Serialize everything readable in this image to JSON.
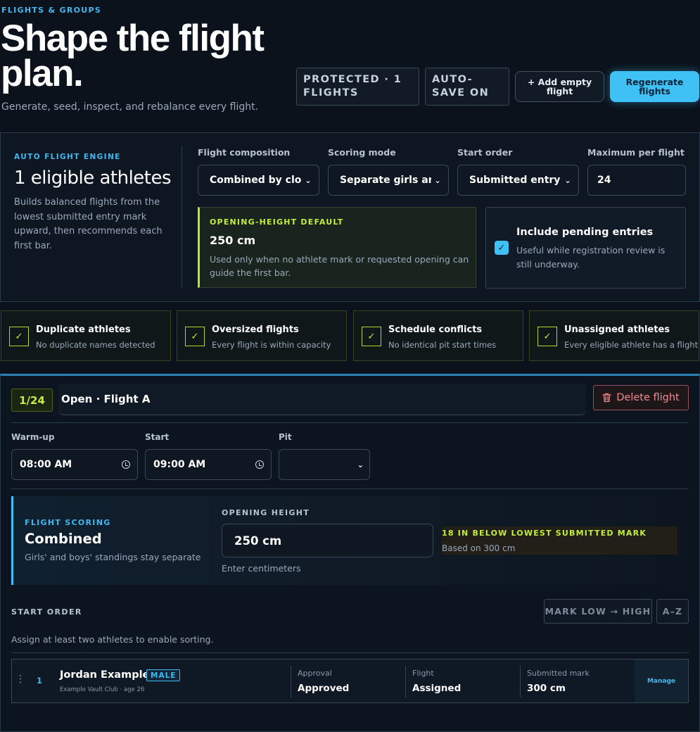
{
  "header": {
    "eyebrow": "FLIGHTS & GROUPS",
    "title": "Shape the flight plan.",
    "subtitle": "Generate, seed, inspect, and rebalance every flight.",
    "protected_pill": "PROTECTED · 1 FLIGHTS",
    "autosave_pill": "AUTO-SAVE ON",
    "add_empty_label": "+ Add empty flight",
    "regenerate_label": "Regenerate flights"
  },
  "engine": {
    "eyebrow": "AUTO FLIGHT ENGINE",
    "title": "1 eligible athletes",
    "description": "Builds balanced flights from the lowest submitted entry mark upward, then recommends each first bar.",
    "composition": {
      "label": "Flight composition",
      "value": "Combined by closest mark"
    },
    "scoring": {
      "label": "Scoring mode",
      "value": "Separate girls and boys"
    },
    "start_order": {
      "label": "Start order",
      "value": "Submitted entry mark"
    },
    "max_per_flight": {
      "label": "Maximum per flight",
      "value": "24"
    },
    "opening_default": {
      "eyebrow": "OPENING-HEIGHT DEFAULT",
      "value": "250 cm",
      "description": "Used only when no athlete mark or requested opening can guide the first bar."
    },
    "pending": {
      "checked": true,
      "title": "Include pending entries",
      "description": "Useful while registration review is still underway."
    }
  },
  "checks": [
    {
      "title": "Duplicate athletes",
      "desc": "No duplicate names detected"
    },
    {
      "title": "Oversized flights",
      "desc": "Every flight is within capacity"
    },
    {
      "title": "Schedule conflicts",
      "desc": "No identical pit start times"
    },
    {
      "title": "Unassigned athletes",
      "desc": "Every eligible athlete has a flight"
    }
  ],
  "flight": {
    "count": "1/24",
    "name": "Open · Flight A",
    "delete_label": "Delete flight",
    "warmup": {
      "label": "Warm-up",
      "value": "08:00 AM"
    },
    "start": {
      "label": "Start",
      "value": "09:00 AM"
    },
    "pit": {
      "label": "Pit",
      "value": ""
    },
    "scoring": {
      "eyebrow": "FLIGHT SCORING",
      "title": "Combined",
      "desc": "Girls' and boys' standings stay separate"
    },
    "opening": {
      "label": "OPENING HEIGHT",
      "value": "250 cm",
      "hint": "Enter centimeters",
      "mark_note": "18 IN BELOW LOWEST SUBMITTED MARK",
      "mark_sub": "Based on 300 cm"
    },
    "start_order": {
      "label": "START ORDER",
      "sort_mark": "MARK LOW → HIGH",
      "sort_az": "A–Z",
      "hint": "Assign at least two athletes to enable sorting."
    },
    "athletes": [
      {
        "index": "1",
        "name": "Jordan Example",
        "gender": "MALE",
        "club": "Example Vault Club · age 26",
        "approval_label": "Approval",
        "approval": "Approved",
        "flight_label": "Flight",
        "flight": "Assigned",
        "mark_label": "Submitted mark",
        "mark": "300 cm",
        "manage": "Manage"
      }
    ]
  },
  "colors": {
    "accent_blue": "#3fc1f5",
    "accent_lime": "#c5ee3c",
    "danger": "#f08b91",
    "background": "#0b121c"
  }
}
